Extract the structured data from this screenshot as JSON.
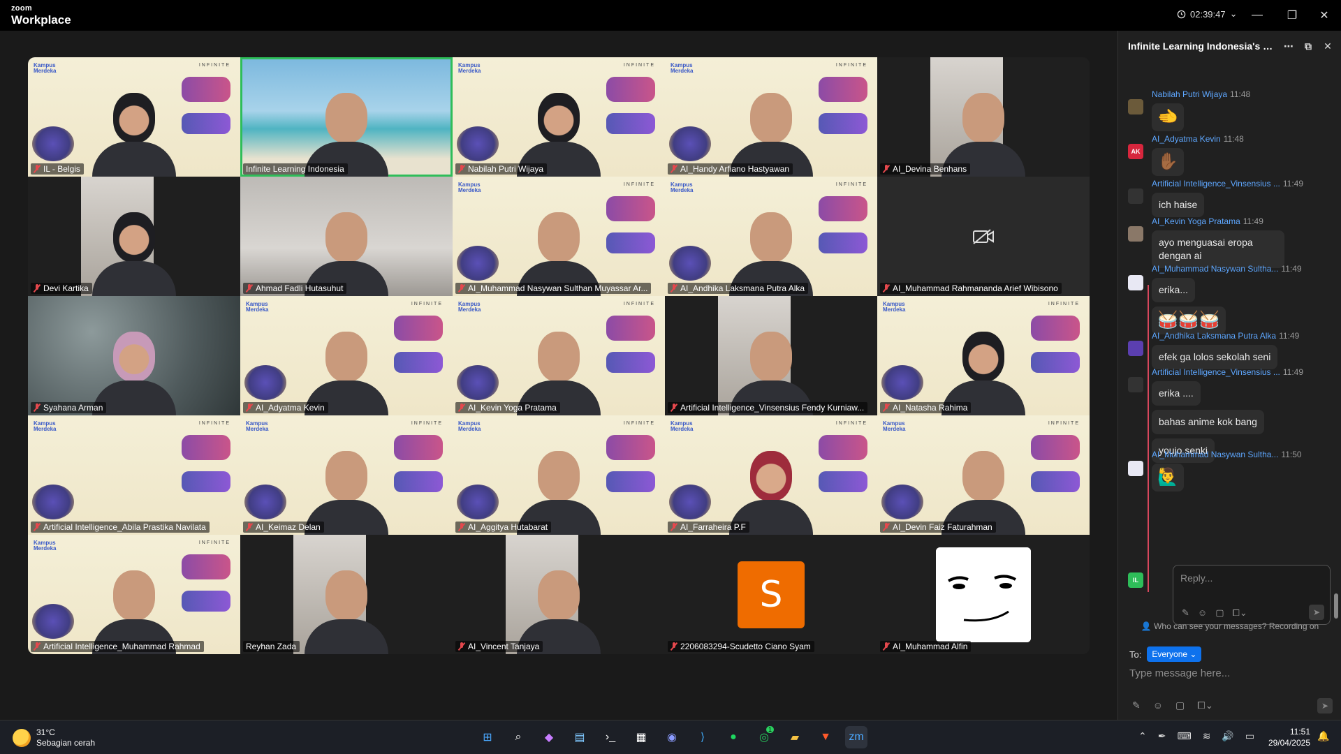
{
  "app": {
    "brand_small": "zoom",
    "brand_large": "Workplace",
    "timer": "02:39:47"
  },
  "participants": [
    {
      "name": "IL - Belgis",
      "bg": "poster",
      "style": "hijab",
      "muted": true
    },
    {
      "name": "Infinite Learning Indonesia",
      "bg": "beach",
      "style": "normal",
      "muted": false,
      "active": true
    },
    {
      "name": "Nabilah Putri Wijaya",
      "bg": "poster",
      "style": "hijab",
      "muted": true
    },
    {
      "name": "AI_Handy Arfiano Hastyawan",
      "bg": "poster",
      "style": "normal",
      "muted": true
    },
    {
      "name": "AI_Devina Benhans",
      "bg": "cam-narrow",
      "style": "normal",
      "muted": true
    },
    {
      "name": "Devi Kartika",
      "bg": "cam-narrow",
      "style": "hijab",
      "muted": true
    },
    {
      "name": "Ahmad Fadli Hutasuhut",
      "bg": "room",
      "style": "normal",
      "muted": true
    },
    {
      "name": "AI_Muhammad Nasywan Sulthan Muyassar Ar...",
      "bg": "poster",
      "style": "normal",
      "muted": true
    },
    {
      "name": "AI_Andhika Laksmana Putra Alka",
      "bg": "poster",
      "style": "normal",
      "muted": true
    },
    {
      "name": "AI_Muhammad Rahmananda Arief Wibisono",
      "bg": "cam-off",
      "style": "none",
      "muted": true
    },
    {
      "name": "Syahana Arman",
      "bg": "floral",
      "style": "pink",
      "muted": true
    },
    {
      "name": "AI_Adyatma Kevin",
      "bg": "poster",
      "style": "normal",
      "muted": true
    },
    {
      "name": "AI_Kevin Yoga Pratama",
      "bg": "poster",
      "style": "normal",
      "muted": true
    },
    {
      "name": "Artificial Intelligence_Vinsensius Fendy Kurniaw...",
      "bg": "cam-narrow",
      "style": "normal",
      "muted": true
    },
    {
      "name": "AI_Natasha Rahima",
      "bg": "poster",
      "style": "hijab",
      "muted": true
    },
    {
      "name": "Artificial Intelligence_Abila Prastika Navilata",
      "bg": "poster",
      "style": "none",
      "muted": true
    },
    {
      "name": "AI_Keimaz Delan",
      "bg": "poster",
      "style": "normal",
      "muted": true
    },
    {
      "name": "AI_Aggitya Hutabarat",
      "bg": "poster",
      "style": "normal",
      "muted": true
    },
    {
      "name": "AI_Farraheira P.F",
      "bg": "poster",
      "style": "red",
      "muted": true
    },
    {
      "name": "AI_Devin Faiz Faturahman",
      "bg": "poster",
      "style": "normal",
      "muted": true
    },
    {
      "name": "Artificial Intelligence_Muhammad Rahmad",
      "bg": "poster",
      "style": "normal",
      "muted": true
    },
    {
      "name": "Reyhan Zada",
      "bg": "cam-narrow",
      "style": "normal",
      "muted": false
    },
    {
      "name": "AI_Vincent Tanjaya",
      "bg": "cam-narrow",
      "style": "normal",
      "muted": true
    },
    {
      "name": "2206083294-Scudetto Ciano Syam",
      "bg": "avatar-s",
      "style": "none",
      "muted": true,
      "avatar_letter": "S"
    },
    {
      "name": "AI_Muhammad Alfin",
      "bg": "avatar-face",
      "style": "none",
      "muted": true
    }
  ],
  "chat": {
    "title": "Infinite Learning Indonesia's Pers...",
    "messages": [
      {
        "sender": "Nabilah Putri Wijaya",
        "time": "11:48",
        "avatar": "",
        "emoji": "🫲"
      },
      {
        "sender": "AI_Adyatma Kevin",
        "time": "11:48",
        "avatar": "AK",
        "emoji": "✋🏾"
      },
      {
        "sender": "Artificial Intelligence_Vinsensius ...",
        "time": "11:49",
        "avatar": "",
        "text": "ich haise"
      },
      {
        "sender": "AI_Kevin Yoga Pratama",
        "time": "11:49",
        "avatar": "",
        "text": "ayo menguasai eropa dengan ai"
      },
      {
        "sender": "AI_Muhammad Nasywan Sultha...",
        "time": "11:49",
        "avatar": "",
        "text": "erika...",
        "emoji": "🥁🥁🥁"
      },
      {
        "sender": "AI_Andhika Laksmana Putra Alka",
        "time": "11:49",
        "avatar": "",
        "text": "efek ga lolos sekolah seni"
      },
      {
        "sender": "Artificial Intelligence_Vinsensius ...",
        "time": "11:49",
        "avatar": "",
        "text": "erika ....",
        "extra": [
          "bahas anime kok bang",
          "youjo senki"
        ]
      },
      {
        "sender": "AI_Muhammad Nasywan Sultha...",
        "time": "11:50",
        "avatar": "",
        "emoji": "🙋‍♂️"
      }
    ],
    "reply_placeholder": "Reply...",
    "self_avatar": "IL",
    "notice": "Who can see your messages? Recording on",
    "to_label": "To:",
    "to_value": "Everyone",
    "input_placeholder": "Type message here..."
  },
  "taskbar": {
    "temp": "31°C",
    "weather": "Sebagian cerah",
    "time": "11:51",
    "date": "29/04/2025",
    "whatsapp_badge": "1"
  },
  "colors": {
    "active_speaker": "#2ebd59",
    "chat_sender": "#5ea7ff",
    "to_pill": "#0e72ed",
    "muted_mic": "#e5484d"
  }
}
